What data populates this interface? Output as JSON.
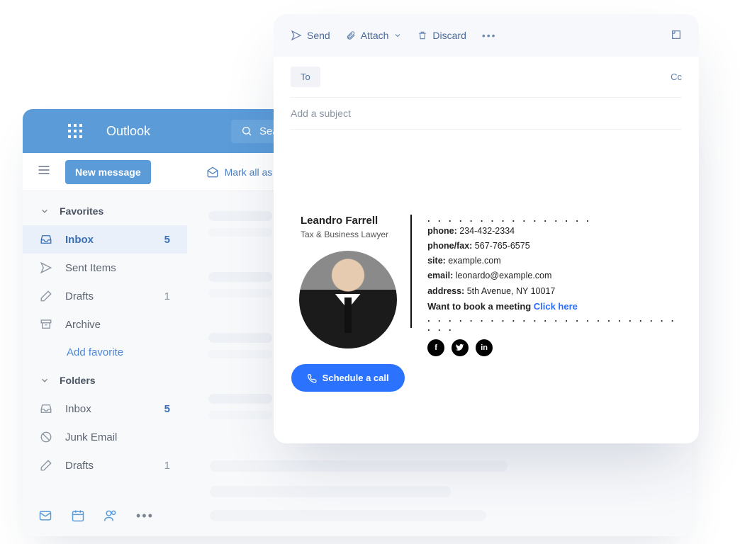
{
  "outlook": {
    "title": "Outlook",
    "search_placeholder": "Search",
    "new_message": "New message",
    "mark_all": "Mark all as read",
    "sections": {
      "favorites": "Favorites",
      "folders": "Folders"
    },
    "nav": {
      "inbox": "Inbox",
      "inbox_badge": "5",
      "sent": "Sent Items",
      "drafts": "Drafts",
      "drafts_badge": "1",
      "archive": "Archive",
      "add_favorite": "Add favorite",
      "f_inbox": "Inbox",
      "f_inbox_badge": "5",
      "junk": "Junk Email",
      "f_drafts": "Drafts",
      "f_drafts_badge": "1"
    }
  },
  "compose": {
    "send": "Send",
    "attach": "Attach",
    "discard": "Discard",
    "to": "To",
    "cc": "Cc",
    "subject_placeholder": "Add a subject"
  },
  "signature": {
    "name": "Leandro Farrell",
    "title": "Tax & Business Lawyer",
    "phone_label": "phone:",
    "phone": "234-432-2334",
    "fax_label": "phone/fax:",
    "fax": "567-765-6575",
    "site_label": "site:",
    "site": "example.com",
    "email_label": "email:",
    "email": "leonardo@example.com",
    "address_label": "address:",
    "address": "5th Avenue, NY 10017",
    "cta_text": "Want to book a meeting",
    "cta_link": "Click here",
    "schedule": "Schedule a call",
    "socials": {
      "fb": "f",
      "tw": "t",
      "in": "in"
    }
  }
}
